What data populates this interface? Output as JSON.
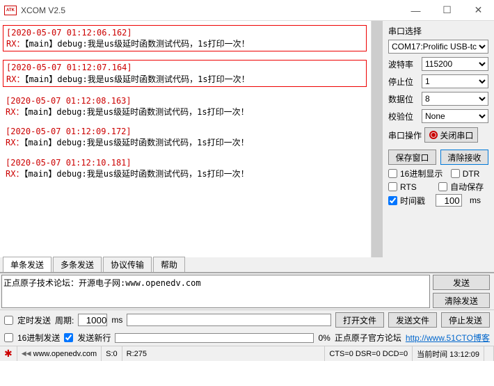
{
  "window": {
    "title": "XCOM V2.5",
    "logo_text": "ATK\nCOM"
  },
  "terminal": {
    "entries": [
      {
        "ts": "[2020-05-07 01:12:06.162]",
        "text": "RX：【main】debug:我是us级延时函数测试代码，1s打印一次！",
        "boxed": true
      },
      {
        "ts": "[2020-05-07 01:12:07.164]",
        "text": "RX：【main】debug:我是us级延时函数测试代码，1s打印一次！",
        "boxed": true
      },
      {
        "ts": "[2020-05-07 01:12:08.163]",
        "text": "RX：【main】debug:我是us级延时函数测试代码，1s打印一次！",
        "boxed": false
      },
      {
        "ts": "[2020-05-07 01:12:09.172]",
        "text": "RX：【main】debug:我是us级延时函数测试代码，1s打印一次！",
        "boxed": false
      },
      {
        "ts": "[2020-05-07 01:12:10.181]",
        "text": "RX：【main】debug:我是us级延时函数测试代码，1s打印一次！",
        "boxed": false
      }
    ]
  },
  "side": {
    "title": "串口选择",
    "port": "COM17:Prolific USB-tc",
    "baud_label": "波特率",
    "baud": "115200",
    "stop_label": "停止位",
    "stop": "1",
    "data_label": "数据位",
    "data": "8",
    "parity_label": "校验位",
    "parity": "None",
    "op_label": "串口操作",
    "op_btn": "关闭串口",
    "save_win": "保存窗口",
    "clear_rx": "清除接收",
    "hex_disp": "16进制显示",
    "dtr": "DTR",
    "rts": "RTS",
    "autosave": "自动保存",
    "timestamp": "时间戳",
    "ts_val": "100",
    "ms": "ms"
  },
  "tabs": {
    "t0": "单条发送",
    "t1": "多条发送",
    "t2": "协议传输",
    "t3": "帮助"
  },
  "send": {
    "text": "正点原子技术论坛：开源电子网:www.openedv.com",
    "send_btn": "发送",
    "clear_btn": "清除发送"
  },
  "ctrl": {
    "timed_send": "定时发送",
    "period_label": "周期:",
    "period_val": "1000",
    "ms": "ms",
    "open_file": "打开文件",
    "send_file": "发送文件",
    "stop_send": "停止发送",
    "hex_send": "16进制发送",
    "send_newline": "发送新行",
    "pct": "0%",
    "forum_text": "正点原子官方论坛",
    "forum_url": "http://www.51CTO博客"
  },
  "status": {
    "site": "www.openedv.com",
    "s": "S:0",
    "r": "R:275",
    "line": "CTS=0 DSR=0 DCD=0",
    "time": "当前时间 13:12:09"
  }
}
